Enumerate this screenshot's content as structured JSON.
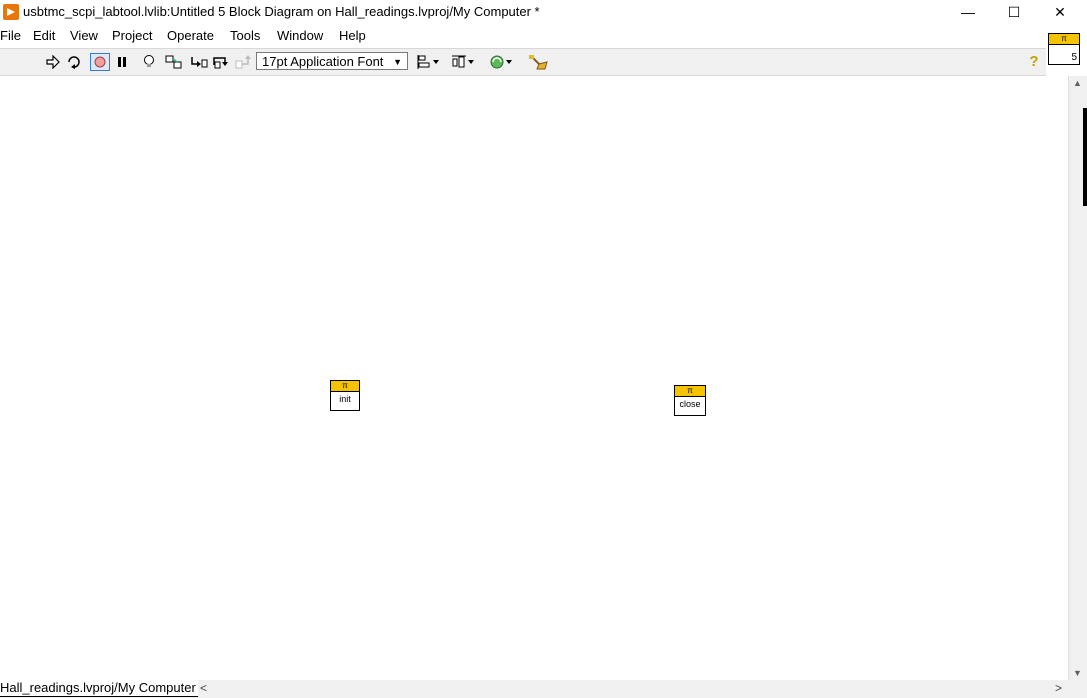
{
  "window": {
    "title": "usbtmc_scpi_labtool.lvlib:Untitled 5 Block Diagram on Hall_readings.lvproj/My Computer *",
    "minimize": "—",
    "maximize": "☐",
    "close": "✕"
  },
  "menu": [
    "File",
    "Edit",
    "View",
    "Project",
    "Operate",
    "Tools",
    "Window",
    "Help"
  ],
  "toolbar": {
    "font": "17pt Application Font",
    "help": "?"
  },
  "vi_icon": {
    "glyph": "π",
    "number": "5"
  },
  "diagram": {
    "nodes": [
      {
        "glyph": "π",
        "label": "init"
      },
      {
        "glyph": "π",
        "label": "close"
      }
    ]
  },
  "status": {
    "context": "Hall_readings.lvproj/My Computer",
    "scroll_left": "<",
    "scroll_right": ">"
  },
  "colors": {
    "app_icon": "#e8760a",
    "subvi_header": "#f5c400"
  }
}
